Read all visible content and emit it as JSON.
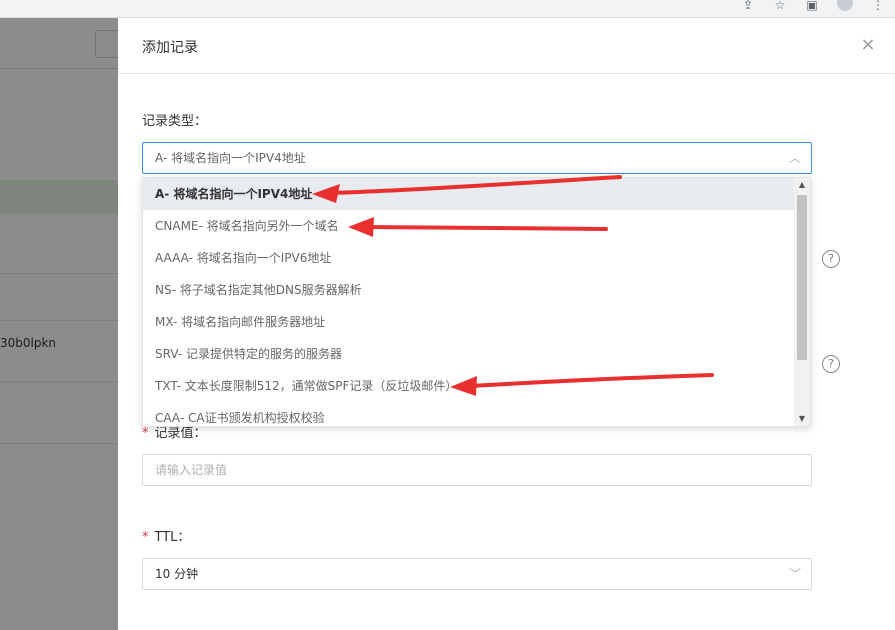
{
  "browser": {
    "icons": [
      "share-icon",
      "star-icon",
      "sidebar-icon",
      "profile-icon",
      "more-icon"
    ]
  },
  "background": {
    "cell_text": "30b0lpkn"
  },
  "drawer": {
    "title": "添加记录",
    "close_label": "×",
    "record_type": {
      "label": "记录类型：",
      "value": "A- 将域名指向一个IPV4地址",
      "options": [
        "A- 将域名指向一个IPV4地址",
        "CNAME- 将域名指向另外一个域名",
        "AAAA- 将域名指向一个IPV6地址",
        "NS- 将子域名指定其他DNS服务器解析",
        "MX- 将域名指向邮件服务器地址",
        "SRV- 记录提供特定的服务的服务器",
        "TXT- 文本长度限制512，通常做SPF记录（反垃圾邮件）",
        "CAA- CA证书颁发机构授权校验"
      ],
      "selected_index": 0
    },
    "record_value": {
      "label": "记录值：",
      "placeholder": "请输入记录值"
    },
    "ttl": {
      "label": "TTL：",
      "value": "10 分钟"
    },
    "help_symbol": "?"
  },
  "colors": {
    "accent": "#3a8ee6",
    "arrow": "#e8312f",
    "required": "#e4393c"
  }
}
